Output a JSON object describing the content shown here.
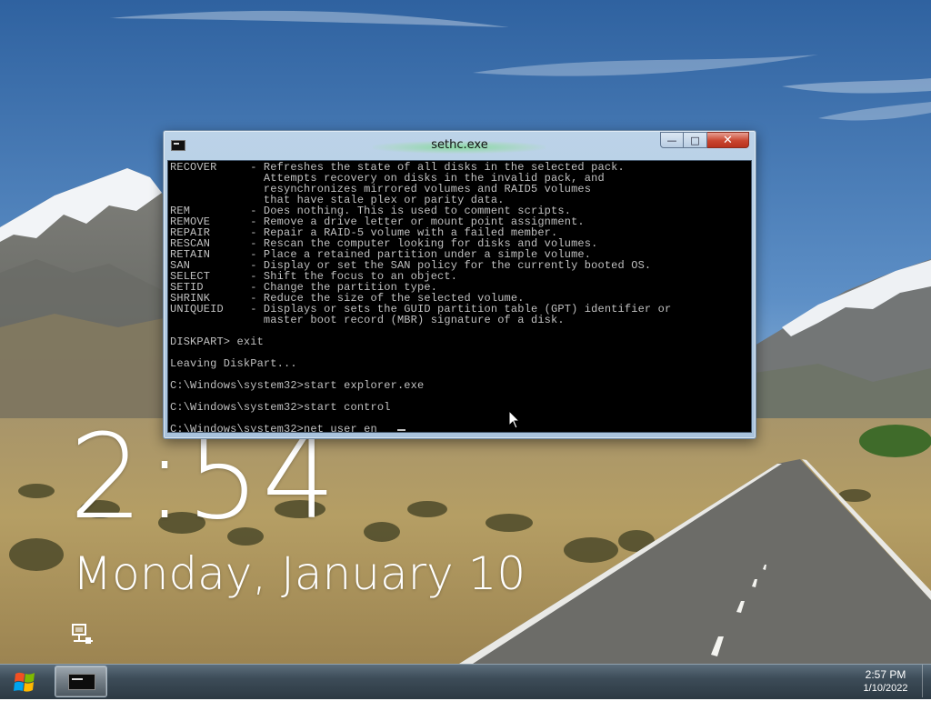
{
  "window": {
    "title": "sethc.exe",
    "minimize_glyph": "—",
    "maximize_glyph": "□",
    "close_glyph": "✕",
    "icon": "console-icon"
  },
  "console": {
    "lines": [
      "RECOVER     - Refreshes the state of all disks in the selected pack.",
      "              Attempts recovery on disks in the invalid pack, and",
      "              resynchronizes mirrored volumes and RAID5 volumes",
      "              that have stale plex or parity data.",
      "REM         - Does nothing. This is used to comment scripts.",
      "REMOVE      - Remove a drive letter or mount point assignment.",
      "REPAIR      - Repair a RAID-5 volume with a failed member.",
      "RESCAN      - Rescan the computer looking for disks and volumes.",
      "RETAIN      - Place a retained partition under a simple volume.",
      "SAN         - Display or set the SAN policy for the currently booted OS.",
      "SELECT      - Shift the focus to an object.",
      "SETID       - Change the partition type.",
      "SHRINK      - Reduce the size of the selected volume.",
      "UNIQUEID    - Displays or sets the GUID partition table (GPT) identifier or",
      "              master boot record (MBR) signature of a disk.",
      "",
      "DISKPART> exit",
      "",
      "Leaving DiskPart...",
      "",
      "C:\\Windows\\system32>start explorer.exe",
      "",
      "C:\\Windows\\system32>start control",
      "",
      "C:\\Windows\\system32>net user en"
    ]
  },
  "lockscreen": {
    "time": "2:54",
    "date": "Monday, January 10",
    "network_icon": "network-icon"
  },
  "taskbar": {
    "start_icon": "windows-logo-icon",
    "console_icon": "console-icon",
    "tray_time": "2:57 PM",
    "tray_date": "1/10/2022"
  },
  "colors": {
    "console_bg": "#000000",
    "console_fg": "#c0c0c0",
    "window_frame": "#a9c3dd",
    "close_button": "#c9452f",
    "taskbar": "#3d4c58",
    "sky": "#3d6fa8"
  }
}
